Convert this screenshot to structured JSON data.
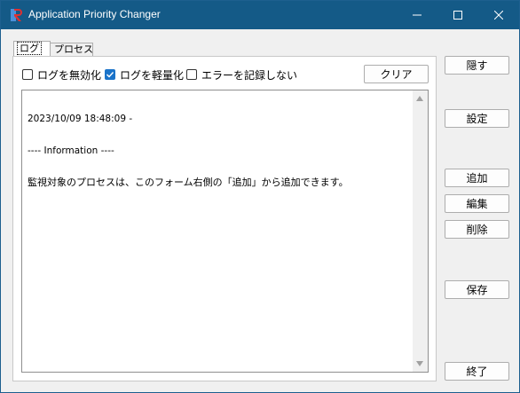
{
  "window": {
    "title": "Application Priority Changer",
    "colors": {
      "titlebar": "#145a87",
      "accent": "#1a73c9"
    },
    "icons": {
      "app": "app-logo-icon",
      "minimize": "minimize-icon",
      "maximize": "maximize-icon",
      "close": "close-icon"
    }
  },
  "tabs": [
    {
      "label": "ログ",
      "selected": true
    },
    {
      "label": "プロセス",
      "selected": false
    }
  ],
  "options": [
    {
      "label": "ログを無効化",
      "checked": false
    },
    {
      "label": "ログを軽量化",
      "checked": true
    },
    {
      "label": "エラーを記録しない",
      "checked": false
    }
  ],
  "clear_label": "クリア",
  "log": {
    "line1": "2023/10/09 18:48:09 -",
    "line2": "---- Information ----",
    "line3": "監視対象のプロセスは、このフォーム右側の「追加」から追加できます。"
  },
  "side_buttons": {
    "hide": "隠す",
    "settings": "設定",
    "add": "追加",
    "edit": "編集",
    "delete": "削除",
    "save": "保存",
    "exit": "終了"
  }
}
